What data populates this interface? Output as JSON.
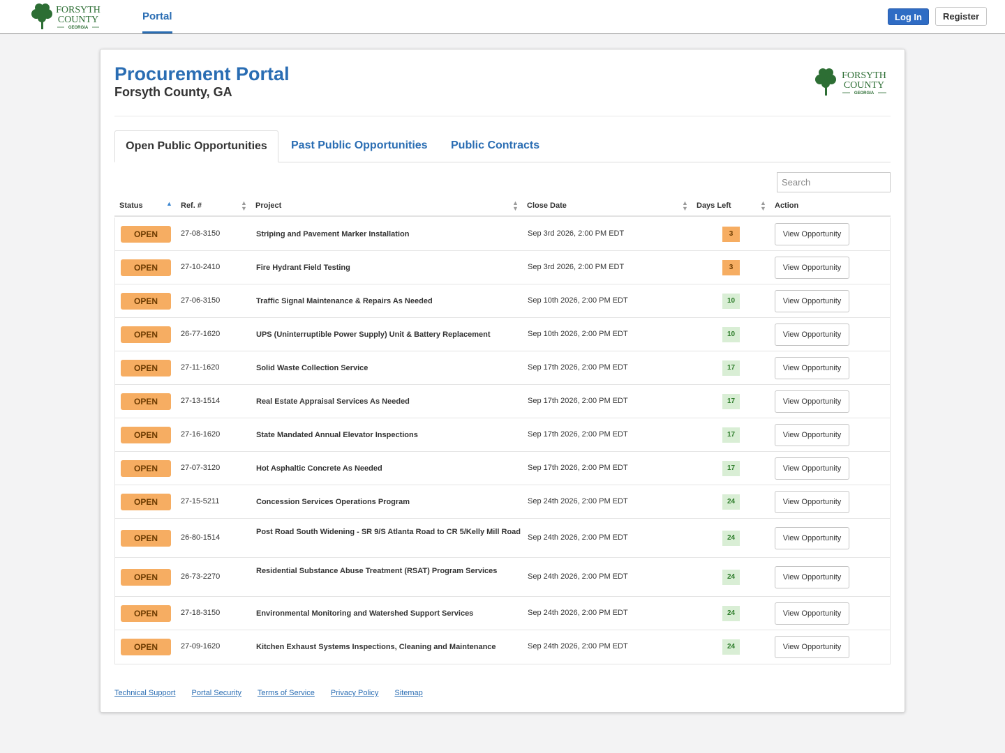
{
  "nav": {
    "logo_text": {
      "line1": "FORSYTH",
      "line2": "COUNTY",
      "line3": "GEORGIA"
    },
    "portal_label": "Portal",
    "login_label": "Log In",
    "register_label": "Register"
  },
  "header": {
    "title": "Procurement Portal",
    "subtitle": "Forsyth County, GA"
  },
  "tabs": [
    {
      "label": "Open Public Opportunities",
      "active": true
    },
    {
      "label": "Past Public Opportunities",
      "active": false
    },
    {
      "label": "Public Contracts",
      "active": false
    }
  ],
  "search": {
    "placeholder": "Search",
    "value": ""
  },
  "table": {
    "columns": [
      "Status",
      "Ref. #",
      "Project",
      "Close Date",
      "Days Left",
      "Action"
    ],
    "rows": [
      {
        "status": "OPEN",
        "ref": "27-08-3150",
        "project": "Striping and Pavement Marker Installation",
        "close": "Sep 3rd 2026, 2:00 PM EDT",
        "days": "3",
        "level": "warn",
        "action": "View Opportunity"
      },
      {
        "status": "OPEN",
        "ref": "27-10-2410",
        "project": "Fire Hydrant Field Testing",
        "close": "Sep 3rd 2026, 2:00 PM EDT",
        "days": "3",
        "level": "warn",
        "action": "View Opportunity"
      },
      {
        "status": "OPEN",
        "ref": "27-06-3150",
        "project": "Traffic Signal Maintenance & Repairs As Needed",
        "close": "Sep 10th 2026, 2:00 PM EDT",
        "days": "10",
        "level": "ok",
        "action": "View Opportunity"
      },
      {
        "status": "OPEN",
        "ref": "26-77-1620",
        "project": "UPS (Uninterruptible Power Supply) Unit & Battery Replacement",
        "close": "Sep 10th 2026, 2:00 PM EDT",
        "days": "10",
        "level": "ok",
        "action": "View Opportunity"
      },
      {
        "status": "OPEN",
        "ref": "27-11-1620",
        "project": "Solid Waste Collection Service",
        "close": "Sep 17th 2026, 2:00 PM EDT",
        "days": "17",
        "level": "ok",
        "action": "View Opportunity"
      },
      {
        "status": "OPEN",
        "ref": "27-13-1514",
        "project": "Real Estate Appraisal Services As Needed",
        "close": "Sep 17th 2026, 2:00 PM EDT",
        "days": "17",
        "level": "ok",
        "action": "View Opportunity"
      },
      {
        "status": "OPEN",
        "ref": "27-16-1620",
        "project": "State Mandated Annual Elevator Inspections",
        "close": "Sep 17th 2026, 2:00 PM EDT",
        "days": "17",
        "level": "ok",
        "action": "View Opportunity"
      },
      {
        "status": "OPEN",
        "ref": "27-07-3120",
        "project": "Hot Asphaltic Concrete As Needed",
        "close": "Sep 17th 2026, 2:00 PM EDT",
        "days": "17",
        "level": "ok",
        "action": "View Opportunity"
      },
      {
        "status": "OPEN",
        "ref": "27-15-5211",
        "project": "Concession Services Operations Program",
        "close": "Sep 24th 2026, 2:00 PM EDT",
        "days": "24",
        "level": "ok",
        "action": "View Opportunity"
      },
      {
        "status": "OPEN",
        "ref": "26-80-1514",
        "project": "Post Road South Widening - SR 9/S Atlanta Road to CR 5/Kelly Mill Road",
        "close": "Sep 24th 2026, 2:00 PM EDT",
        "days": "24",
        "level": "ok",
        "action": "View Opportunity"
      },
      {
        "status": "OPEN",
        "ref": "26-73-2270",
        "project": "Residential Substance Abuse Treatment (RSAT) Program Services",
        "close": "Sep 24th 2026, 2:00 PM EDT",
        "days": "24",
        "level": "ok",
        "action": "View Opportunity"
      },
      {
        "status": "OPEN",
        "ref": "27-18-3150",
        "project": "Environmental Monitoring and Watershed Support Services",
        "close": "Sep 24th 2026, 2:00 PM EDT",
        "days": "24",
        "level": "ok",
        "action": "View Opportunity"
      },
      {
        "status": "OPEN",
        "ref": "27-09-1620",
        "project": "Kitchen Exhaust Systems Inspections, Cleaning and Maintenance",
        "close": "Sep 24th 2026, 2:00 PM EDT",
        "days": "24",
        "level": "ok",
        "action": "View Opportunity"
      }
    ]
  },
  "footer": {
    "links": [
      "Technical Support",
      "Portal Security",
      "Terms of Service",
      "Privacy Policy",
      "Sitemap"
    ]
  },
  "colors": {
    "brand_blue": "#2a6db3",
    "status_orange": "#f6ad62",
    "days_ok_bg": "#d9eed5",
    "logo_green": "#2d6e34"
  }
}
